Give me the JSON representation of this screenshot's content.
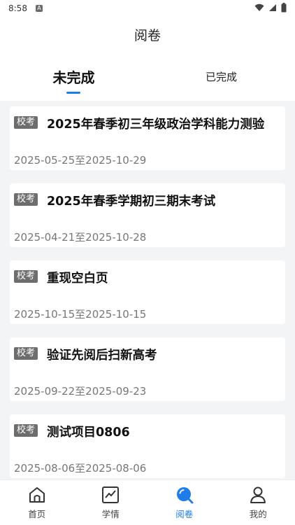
{
  "status_bar": {
    "time": "8:58",
    "notification_letter": "A"
  },
  "header": {
    "title": "阅卷"
  },
  "tabs": [
    {
      "label": "未完成",
      "active": true
    },
    {
      "label": "已完成",
      "active": false
    }
  ],
  "exams": [
    {
      "badge": "校考",
      "title": "2025年春季初三年级政治学科能力测验",
      "date": "2025-05-25至2025-10-29"
    },
    {
      "badge": "校考",
      "title": "2025年春季学期初三期末考试",
      "date": "2025-04-21至2025-10-28"
    },
    {
      "badge": "校考",
      "title": "重现空白页",
      "date": "2025-10-15至2025-10-15"
    },
    {
      "badge": "校考",
      "title": "验证先阅后扫新高考",
      "date": "2025-09-22至2025-09-23"
    },
    {
      "badge": "校考",
      "title": "测试项目0806",
      "date": "2025-08-06至2025-08-06"
    }
  ],
  "bottom_nav": [
    {
      "label": "首页",
      "icon": "home-icon",
      "active": false
    },
    {
      "label": "学情",
      "icon": "trend-chart-icon",
      "active": false
    },
    {
      "label": "阅卷",
      "icon": "search-icon",
      "active": true
    },
    {
      "label": "我的",
      "icon": "user-icon",
      "active": false
    }
  ],
  "colors": {
    "accent": "#1e7de9",
    "badge_bg": "#6d6d6d",
    "page_bg": "#f3f4f6"
  }
}
